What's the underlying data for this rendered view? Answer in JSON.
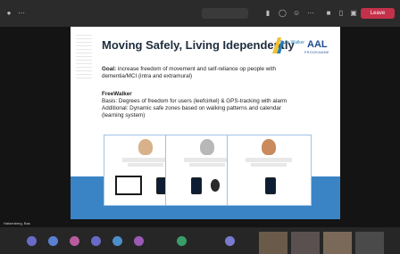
{
  "window": {
    "leave_label": "Leave",
    "participant_label": "Hatzenberg, Bas"
  },
  "slide": {
    "title": "Moving Safely, Living Idependently",
    "logo_freewalker": "Free Walker",
    "logo_aal": "AAL",
    "logo_aal_sub": "PROGRAMME",
    "goal_label": "Goal:",
    "goal_line1": "increase freedom of movement and self-reliance op people with",
    "goal_line2": "dementia/MCI (intra and extramural)",
    "fw_heading": "FreeWalker",
    "basis_line": "Basis: Degrees of freedom for users (leefcirkel) & GPS-tracking with alarm",
    "additional_line1": "Additional: Dynamic safe zones based on walking patterns and calendar",
    "additional_line2": "(learning system)"
  },
  "participants": [
    "",
    "",
    "",
    "",
    "",
    "",
    ""
  ],
  "colors": {
    "accent": "#3a84c6",
    "leave": "#c4314b"
  }
}
